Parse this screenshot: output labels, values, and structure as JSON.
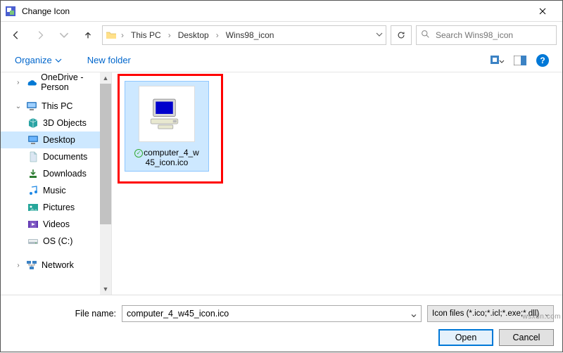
{
  "window": {
    "title": "Change Icon"
  },
  "breadcrumb": {
    "segments": [
      "This PC",
      "Desktop",
      "Wins98_icon"
    ]
  },
  "search": {
    "placeholder": "Search Wins98_icon"
  },
  "toolbar": {
    "organize": "Organize",
    "new_folder": "New folder"
  },
  "tree": {
    "onedrive": "OneDrive - Person",
    "this_pc": "This PC",
    "objects3d": "3D Objects",
    "desktop": "Desktop",
    "documents": "Documents",
    "downloads": "Downloads",
    "music": "Music",
    "pictures": "Pictures",
    "videos": "Videos",
    "osc": "OS (C:)",
    "network": "Network"
  },
  "file": {
    "name_line1": "computer_4_w",
    "name_line2": "45_icon.ico"
  },
  "footer": {
    "filename_label": "File name:",
    "filename_value": "computer_4_w45_icon.ico",
    "filter": "Icon files (*.ico;*.icl;*.exe;*.dll)",
    "open": "Open",
    "cancel": "Cancel"
  },
  "watermark": "wsxdn.com"
}
